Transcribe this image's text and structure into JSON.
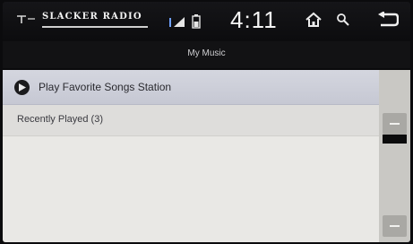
{
  "status_bar": {
    "brand": "SLACKER RADIO",
    "time": "4:11",
    "icons": [
      "antenna-icon",
      "signal-strength-icon",
      "battery-icon",
      "home-icon",
      "search-icon",
      "back-icon"
    ]
  },
  "header": {
    "title": "My Music"
  },
  "list": {
    "station_item": "Play Favorite Songs Station",
    "recent_item": "Recently Played (3)"
  },
  "colors": {
    "background": "#0a0a0c",
    "list_background": "#e9e8e5",
    "selected_row": "#cfd1dc",
    "scroll_thumb": "#0b0b0c"
  }
}
